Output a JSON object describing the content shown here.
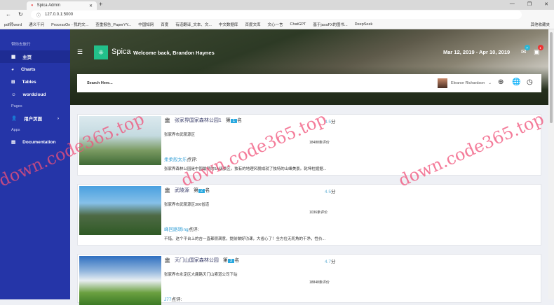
{
  "browser": {
    "tab_title": "Spica Admin",
    "url": "127.0.0.1:5000",
    "bookmarks": [
      "pdf转word",
      "通义千问",
      "ProcessOn - 我的文...",
      "查重报告_PaperYY...",
      "中国知网",
      "百度",
      "有道翻译_文本、文...",
      "中文数据库",
      "百度文库",
      "文心一言",
      "ChatGPT",
      "基于javaFX的图书...",
      "DeepSeek"
    ],
    "other_bookmarks": "其他收藏夹"
  },
  "sidebar": {
    "section1": "带你去旅行",
    "items": [
      {
        "label": "主页",
        "icon": "grid-icon"
      },
      {
        "label": "Charts",
        "icon": "pie-icon"
      },
      {
        "label": "Tables",
        "icon": "table-icon"
      },
      {
        "label": "wordcloud",
        "icon": "smile-icon"
      }
    ],
    "section2": "Pages",
    "pages_item": "用户页面",
    "section3": "Apps",
    "apps_item": "Documentation"
  },
  "header": {
    "brand": "Spica",
    "welcome": "Welcome back, Brandon Haynes",
    "date_range": "Mar 12, 2019 - Apr 10, 2019",
    "mail_badge": "7",
    "cart_badge": "1",
    "search_placeholder": "Search Here...",
    "user_name": "Eleanor Richardson"
  },
  "cards": [
    {
      "name": "张家界国家森林公园1",
      "rank_prefix": "第",
      "rank": "1",
      "rank_suffix": "名",
      "score": "4.5",
      "score_unit": "分",
      "address": "张家界市武陵源区",
      "reviews": "18488条评价",
      "reviewer": "柔柔般太乐",
      "review_label": "点评:",
      "comment": "张家界森林公园是中国最早的5A级景区。独有的地理风貌成就了独特的山峰美景。乾坤柱掘据..."
    },
    {
      "name": "武陵源",
      "rank_prefix": "第",
      "rank": "2",
      "rank_suffix": "名",
      "score": "4.5",
      "score_unit": "分",
      "address": "张家界市武陵源区306省道",
      "reviews": "1036条评价",
      "reviewer": "峰回路转ing",
      "review_label": "点评:",
      "comment": "不错，这个平台上的吉一直都很满意，提前做好功课，大省心了！全方位无死角的干净，性价..."
    },
    {
      "name": "天门山国家森林公园",
      "rank_prefix": "第",
      "rank": "3",
      "rank_suffix": "名",
      "score": "4.7",
      "score_unit": "分",
      "address": "张家界市永定区大庸路天门山索道公司下站",
      "reviews": "18848条评价",
      "reviewer": "J77",
      "review_label": "点评:",
      "comment": ""
    }
  ],
  "watermark": "down.code365.top"
}
